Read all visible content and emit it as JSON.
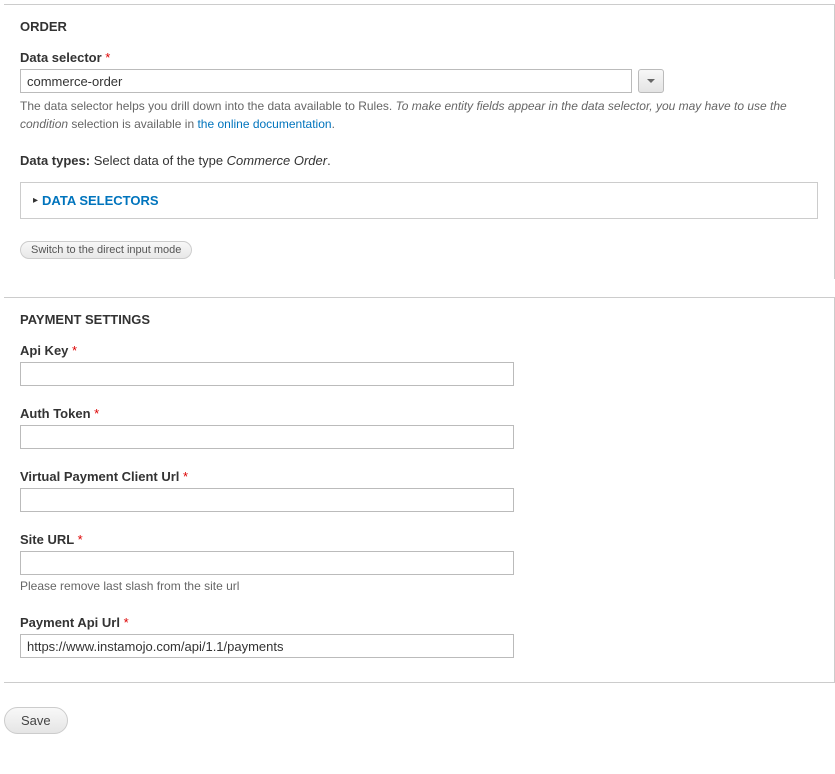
{
  "order": {
    "title": "ORDER",
    "dataSelectorLabel": "Data selector",
    "dataSelectorValue": "commerce-order",
    "helpPrefix": "The data selector helps you drill down into the data available to Rules. ",
    "helpItalic": "To make entity fields appear in the data selector, you may have to use the condition",
    "helpSuffixBeforeLink": " selection is available in ",
    "helpLink": "the online documentation",
    "helpAfterLink": ".",
    "dataTypesLabel": "Data types:",
    "dataTypesText": " Select data of the type ",
    "dataTypesEm": "Commerce Order",
    "dataTypesEnd": ".",
    "collapsibleTitle": "DATA SELECTORS",
    "modeButton": "Switch to the direct input mode"
  },
  "payment": {
    "title": "PAYMENT SETTINGS",
    "apiKeyLabel": "Api Key",
    "apiKeyValue": "",
    "authTokenLabel": "Auth Token",
    "authTokenValue": "",
    "vpcLabel": "Virtual Payment Client Url",
    "vpcValue": "",
    "siteUrlLabel": "Site URL",
    "siteUrlValue": "",
    "siteUrlHelp": "Please remove last slash from the site url",
    "paymentApiLabel": "Payment Api Url",
    "paymentApiValue": "https://www.instamojo.com/api/1.1/payments"
  },
  "save": "Save",
  "requiredMark": "*"
}
